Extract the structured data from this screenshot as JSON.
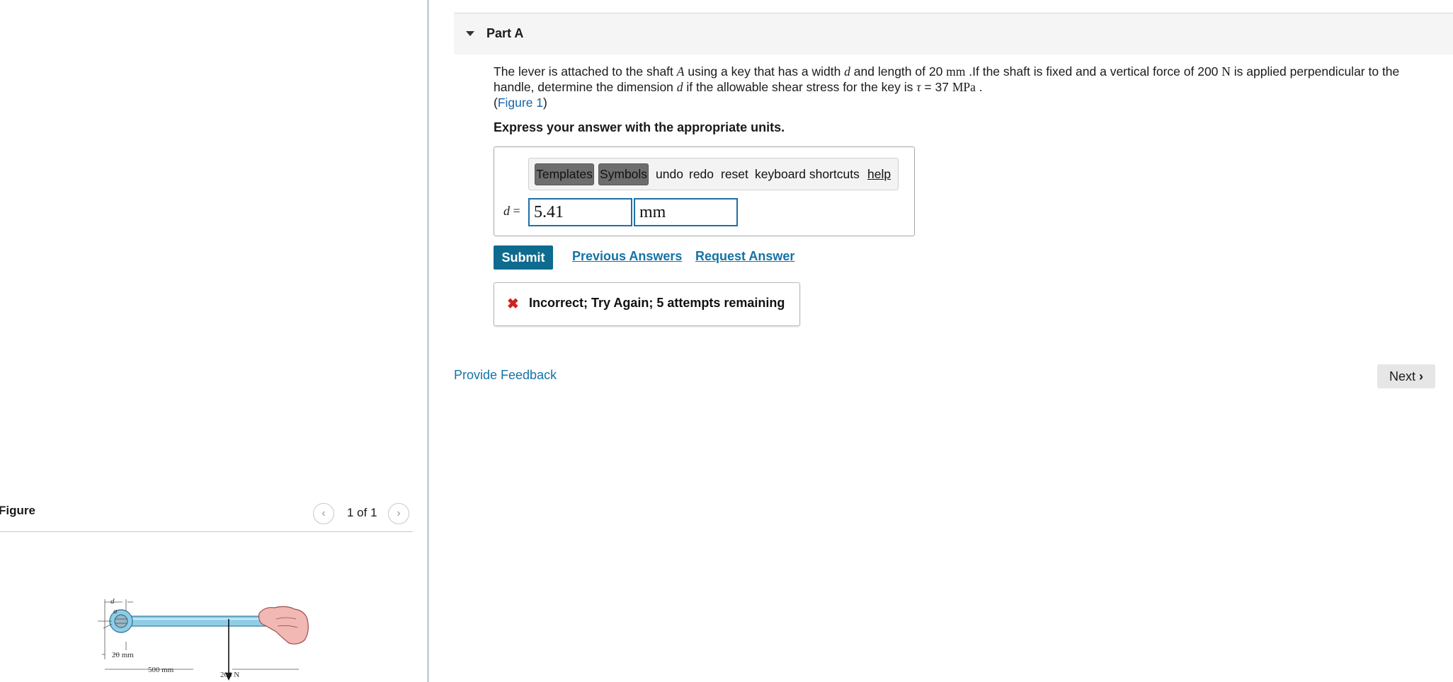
{
  "figure_panel": {
    "title": "Figure",
    "pager": {
      "count": "1 of 1"
    },
    "diagram_labels": {
      "d": "d",
      "a_left": "a",
      "a_right": "a",
      "A": "A",
      "width": "20 mm",
      "length": "500 mm",
      "force": "200 N"
    }
  },
  "part": {
    "title": "Part A",
    "problem": {
      "t1": "The lever is attached to the shaft ",
      "m1": "A",
      "t2": " using a key that has a width ",
      "m2": "d",
      "t3": " and length of 20 ",
      "u1": "mm",
      "t4": " .If the shaft is fixed and a vertical force of 200 ",
      "u2": "N",
      "t5": " is applied perpendicular to the handle, determine the dimension ",
      "m3": "d",
      "t6": " if the allowable shear stress for the key is ",
      "m4": "τ",
      "t7": " = 37 ",
      "u3": "MPa",
      "t8": " .",
      "figure_link_open": "(",
      "figure_link": "Figure 1",
      "figure_link_close": ")"
    },
    "instruction": "Express your answer with the appropriate units."
  },
  "answer": {
    "toolbar": {
      "templates": "Templates",
      "symbols": "Symbols",
      "undo": "undo",
      "redo": "redo",
      "reset": "reset",
      "keyboard": "keyboard shortcuts",
      "help": "help"
    },
    "variable": "d",
    "equals": " =",
    "value": "5.41",
    "unit": "mm"
  },
  "actions": {
    "submit": "Submit",
    "previous_answers": "Previous Answers",
    "request_answer": "Request Answer"
  },
  "feedback": {
    "message": "Incorrect; Try Again; 5 attempts remaining"
  },
  "footer": {
    "provide_feedback": "Provide Feedback",
    "next": "Next"
  },
  "colors": {
    "link": "#1572a6",
    "submit_bg": "#0e6b8f",
    "input_border": "#1f6fa6",
    "error": "#d32020"
  },
  "icons": {
    "part_toggle": "caret-down-icon",
    "pager_prev": "chevron-left-icon",
    "pager_next": "chevron-right-icon",
    "error": "x-icon",
    "next": "chevron-right-icon"
  }
}
